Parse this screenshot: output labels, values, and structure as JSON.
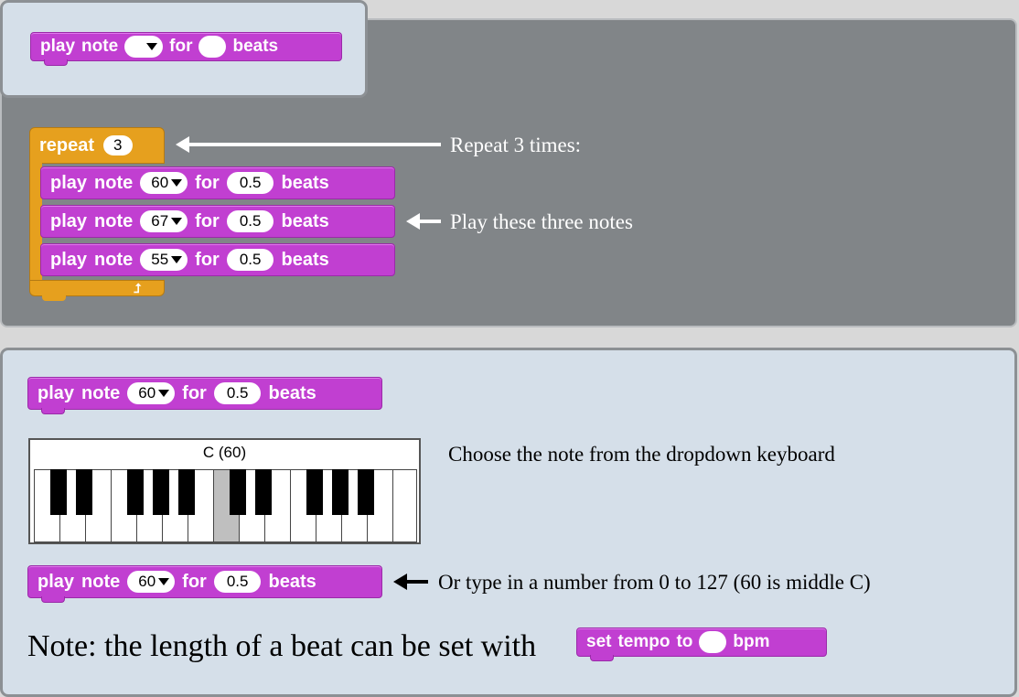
{
  "palette": {
    "block": {
      "play": "play",
      "note": "note",
      "for": "for",
      "beats": "beats"
    }
  },
  "script": {
    "repeat": {
      "label": "repeat",
      "count": "3"
    },
    "blocks": [
      {
        "play": "play",
        "note": "note",
        "pitch": "60",
        "for": "for",
        "duration": "0.5",
        "beats": "beats"
      },
      {
        "play": "play",
        "note": "note",
        "pitch": "67",
        "for": "for",
        "duration": "0.5",
        "beats": "beats"
      },
      {
        "play": "play",
        "note": "note",
        "pitch": "55",
        "for": "for",
        "duration": "0.5",
        "beats": "beats"
      }
    ],
    "callout_repeat": "Repeat 3 times:",
    "callout_notes": "Play these three notes"
  },
  "help": {
    "block1": {
      "play": "play",
      "note": "note",
      "pitch": "60",
      "for": "for",
      "duration": "0.5",
      "beats": "beats"
    },
    "keyboard_title": "C (60)",
    "keyboard_caption": "Choose the note from the dropdown keyboard",
    "block2": {
      "play": "play",
      "note": "note",
      "pitch": "60",
      "for": "for",
      "duration": "0.5",
      "beats": "beats"
    },
    "type_caption": "Or type in a number from 0 to 127 (60 is middle C)",
    "note_text": "Note: the length of a beat can be set with",
    "tempo_block": {
      "set": "set",
      "tempo": "tempo",
      "to": "to",
      "bpm": "bpm"
    }
  },
  "colors": {
    "sound_block": "#c13fd1",
    "control_block": "#e6a01e",
    "script_bg": "#818588",
    "panel_bg": "#d5dfe9"
  }
}
